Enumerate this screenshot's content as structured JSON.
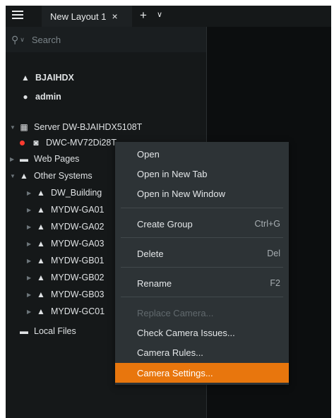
{
  "topbar": {
    "tab_label": "New Layout 1",
    "tab_close": "×",
    "add_tab": "+",
    "tab_menu": "∨"
  },
  "search": {
    "placeholder": "Search"
  },
  "tree": {
    "system_name": "BJAIHDX",
    "user_name": "admin",
    "server": "Server DW-BJAIHDX5108T",
    "camera": "DWC-MV72Di28T",
    "web_pages": "Web Pages",
    "other_systems": "Other Systems",
    "systems": [
      "DW_Building",
      "MYDW-GA01",
      "MYDW-GA02",
      "MYDW-GA03",
      "MYDW-GB01",
      "MYDW-GB02",
      "MYDW-GB03",
      "MYDW-GC01"
    ],
    "local_files": "Local Files"
  },
  "context_menu": {
    "open": "Open",
    "open_new_tab": "Open in New Tab",
    "open_new_window": "Open in New Window",
    "create_group": "Create Group",
    "create_group_shortcut": "Ctrl+G",
    "delete": "Delete",
    "delete_shortcut": "Del",
    "rename": "Rename",
    "rename_shortcut": "F2",
    "replace_camera": "Replace Camera...",
    "check_camera_issues": "Check Camera Issues...",
    "camera_rules": "Camera Rules...",
    "camera_settings": "Camera Settings..."
  },
  "colors": {
    "accent": "#e8760d",
    "status_offline": "#ff3b30"
  }
}
